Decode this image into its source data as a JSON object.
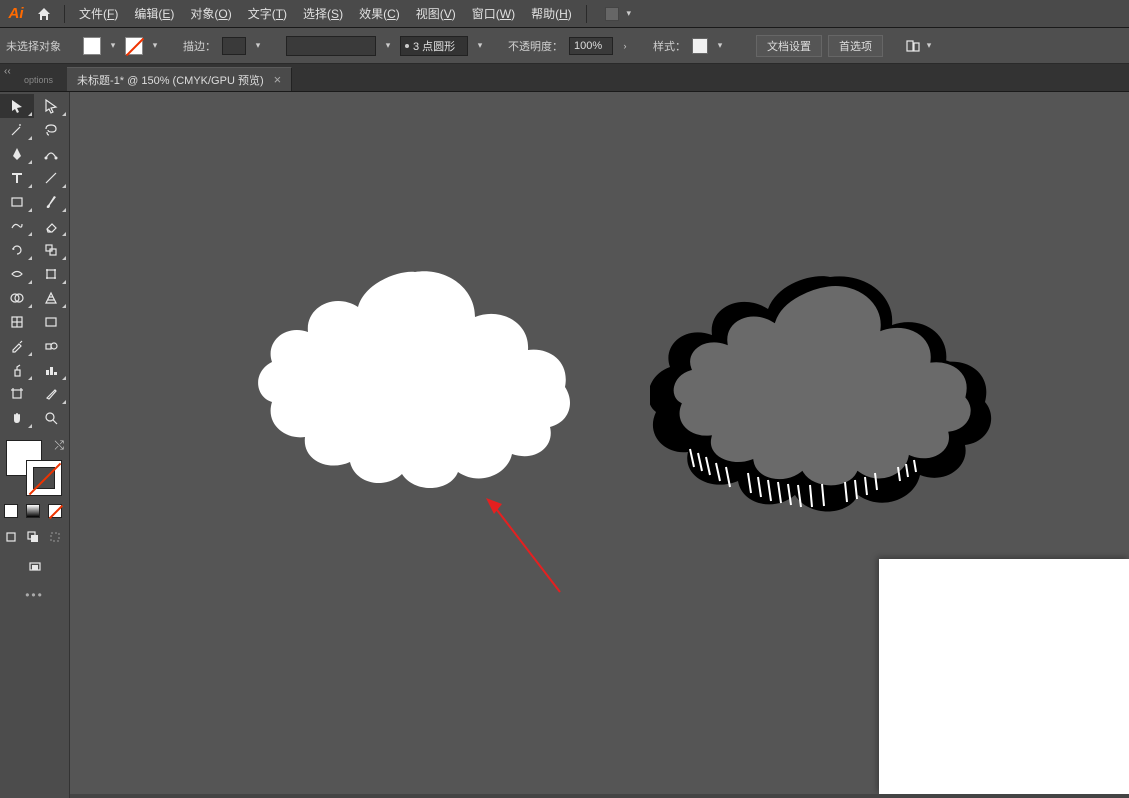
{
  "app": {
    "name": "Ai"
  },
  "menus": {
    "file": {
      "label": "文件(",
      "key": "F",
      "tail": ")"
    },
    "edit": {
      "label": "编辑(",
      "key": "E",
      "tail": ")"
    },
    "object": {
      "label": "对象(",
      "key": "O",
      "tail": ")"
    },
    "type": {
      "label": "文字(",
      "key": "T",
      "tail": ")"
    },
    "select": {
      "label": "选择(",
      "key": "S",
      "tail": ")"
    },
    "effect": {
      "label": "效果(",
      "key": "C",
      "tail": ")"
    },
    "view": {
      "label": "视图(",
      "key": "V",
      "tail": ")"
    },
    "window": {
      "label": "窗口(",
      "key": "W",
      "tail": ")"
    },
    "help": {
      "label": "帮助(",
      "key": "H",
      "tail": ")"
    }
  },
  "controlbar": {
    "no_selection": "未选择对象",
    "stroke_label": "描边：",
    "stroke_weight": "",
    "stroke_profile": "3 点圆形",
    "opacity_label": "不透明度：",
    "opacity_value": "100%",
    "style_label": "样式：",
    "doc_setup": "文档设置",
    "prefs": "首选项"
  },
  "tabbar": {
    "options_label": "options",
    "doc_title": "未标题-1* @ 150% (CMYK/GPU 预览)"
  },
  "tools": {
    "row0": [
      "selection",
      "direct-selection"
    ],
    "row1": [
      "magic-wand",
      "lasso"
    ],
    "row2": [
      "pen",
      "curvature"
    ],
    "row3": [
      "type",
      "line"
    ],
    "row4": [
      "rectangle",
      "paintbrush"
    ],
    "row5": [
      "shaper",
      "eraser"
    ],
    "row6": [
      "rotate",
      "scale"
    ],
    "row7": [
      "width",
      "free-transform"
    ],
    "row8": [
      "shape-builder",
      "perspective"
    ],
    "row9": [
      "mesh",
      "gradient"
    ],
    "row10": [
      "eyedropper",
      "blend"
    ],
    "row11": [
      "symbol-sprayer",
      "column-graph"
    ],
    "row12": [
      "artboard",
      "slice"
    ],
    "row13": [
      "hand",
      "zoom"
    ]
  },
  "colors": {
    "fill": "#ffffff",
    "stroke": "none",
    "canvas_bg": "#555555"
  }
}
